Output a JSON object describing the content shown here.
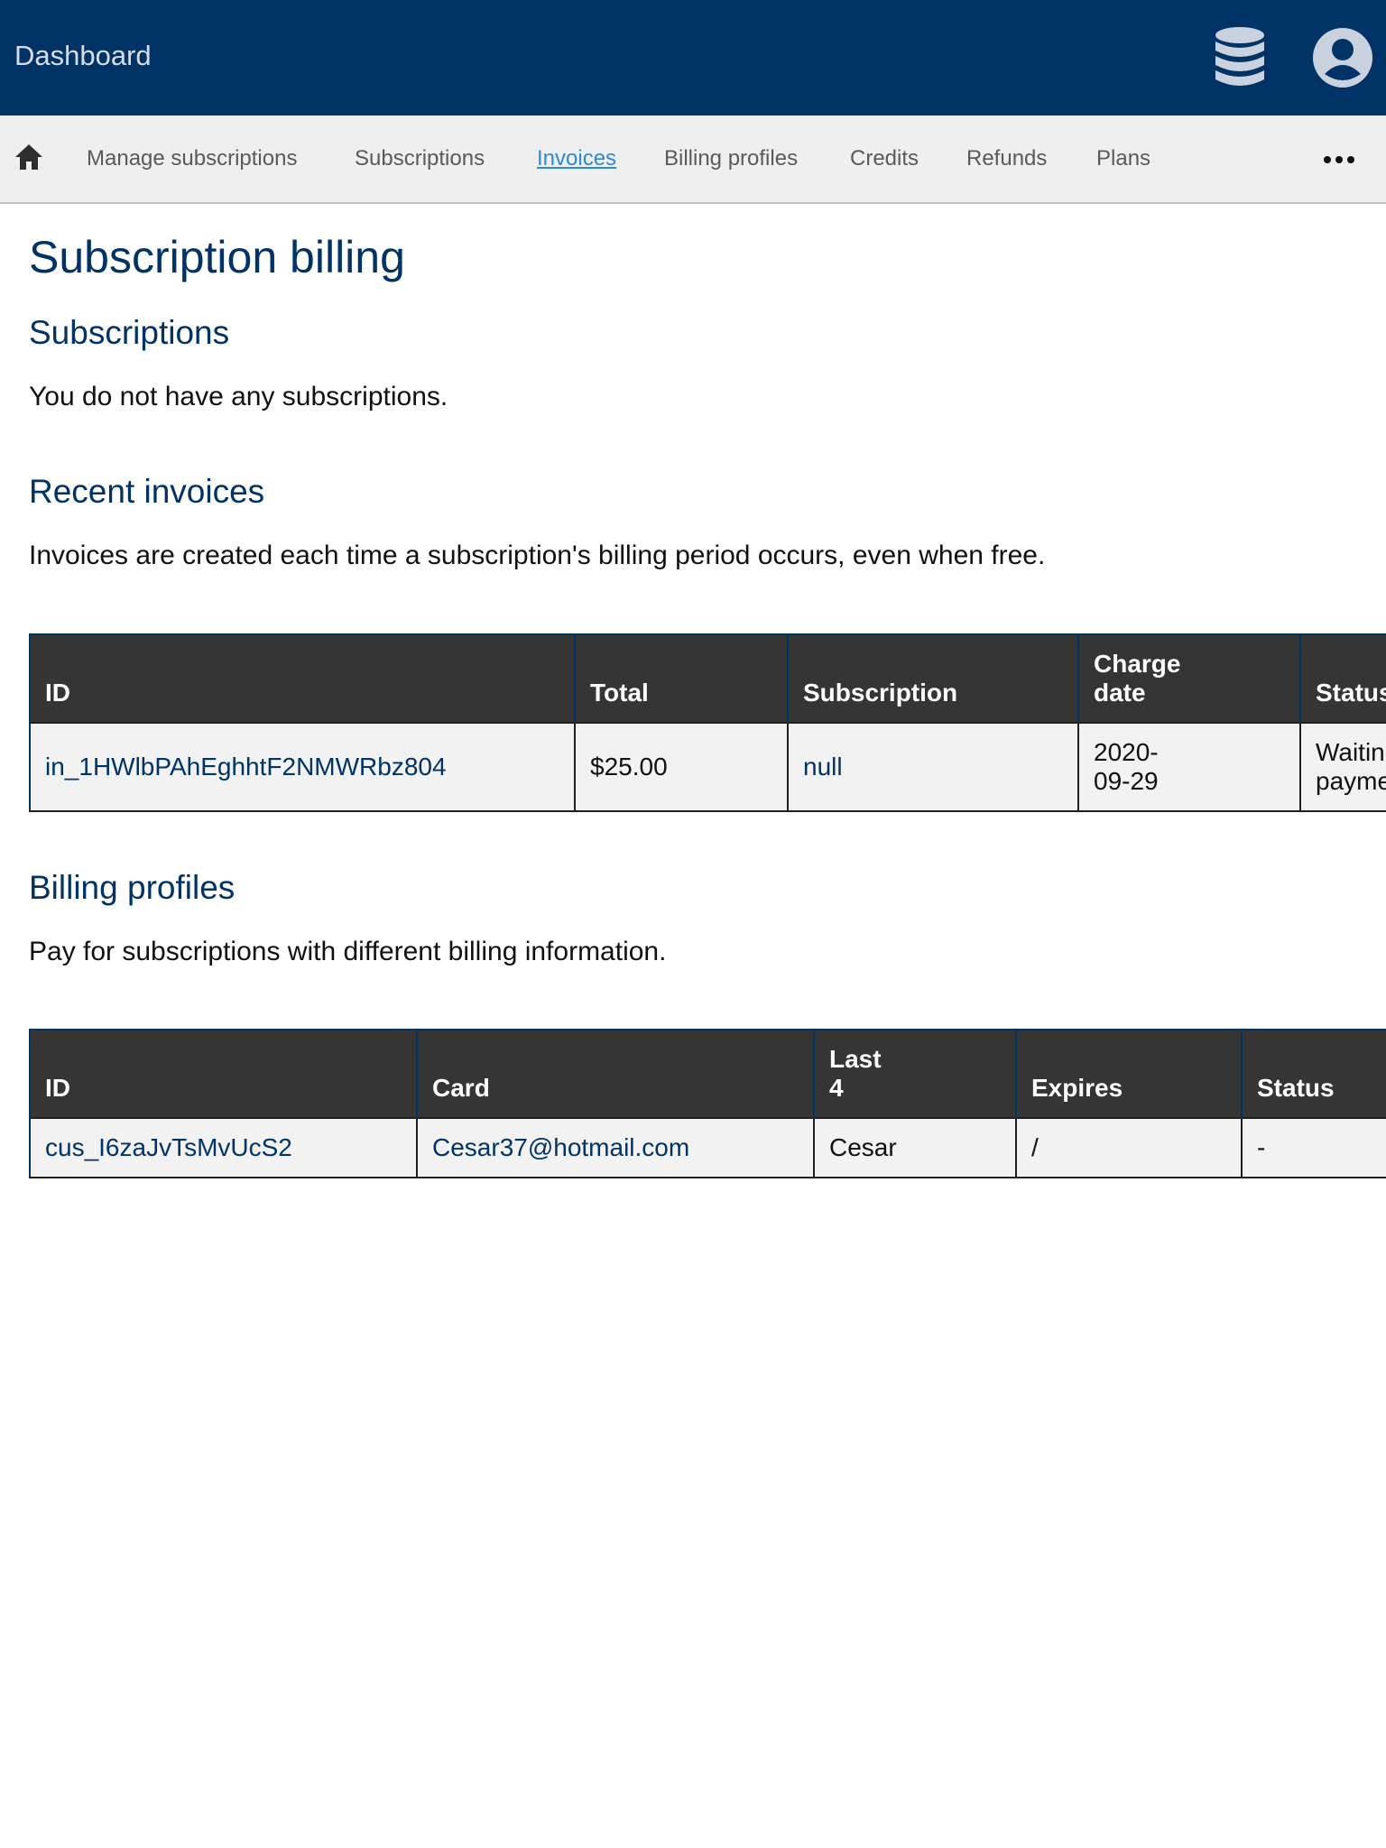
{
  "header": {
    "brand": "Dashboard",
    "icons": [
      "database-icon",
      "user-account-icon"
    ],
    "background_color": "#013366"
  },
  "nav": {
    "home_icon": "home-icon",
    "items": [
      {
        "label": "Manage subscriptions"
      },
      {
        "label": "Subscriptions"
      },
      {
        "label": "Invoices",
        "active": true
      },
      {
        "label": "Billing profiles"
      },
      {
        "label": "Credits"
      },
      {
        "label": "Refunds"
      },
      {
        "label": "Plans"
      }
    ],
    "more_icon": "ellipsis-icon"
  },
  "page": {
    "title": "Subscription billing",
    "subscriptions": {
      "heading": "Subscriptions",
      "empty_text": "You do not have any subscriptions."
    },
    "invoices": {
      "heading": "Recent invoices",
      "description": "Invoices are created each time a subscription's billing period occurs, even when free.",
      "columns": [
        "ID",
        "Total",
        "Subscription",
        "Charge date",
        "Status"
      ],
      "rows": [
        {
          "id": "in_1HWlbPAhEghhtF2NMWRbz804",
          "total": "$25.00",
          "subscription": "null",
          "charge_date": "2020-09-29",
          "status": "Waiting payment"
        }
      ]
    },
    "billing_profiles": {
      "heading": "Billing profiles",
      "description": "Pay for subscriptions with different billing information.",
      "columns": [
        "ID",
        "Card",
        "Last 4",
        "Expires",
        "Status"
      ],
      "rows": [
        {
          "id": "cus_I6zaJvTsMvUcS2",
          "card": "Cesar37@hotmail.com",
          "last4": "Cesar",
          "expires": "/",
          "status": "-"
        }
      ]
    }
  }
}
